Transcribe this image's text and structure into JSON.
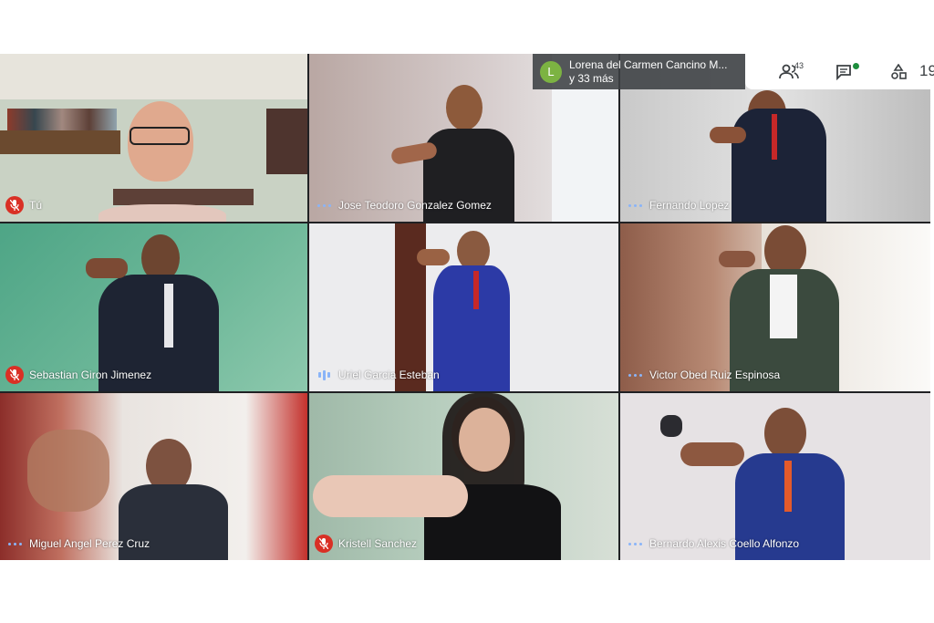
{
  "presenter": {
    "initial": "L",
    "line1": "Lorena del Carmen Cancino M...",
    "line2": "y 33 más"
  },
  "toolbar": {
    "people_icon": "people-icon",
    "participant_count": "43",
    "chat_icon": "chat-icon",
    "activities_icon": "activities-icon",
    "clock_partial": "19"
  },
  "tiles": [
    {
      "name": "Tú",
      "status": "muted"
    },
    {
      "name": "Jose Teodoro Gonzalez Gomez",
      "status": "dots"
    },
    {
      "name": "Fernando Lopez",
      "status": "dots"
    },
    {
      "name": "Sebastian Giron Jimenez",
      "status": "muted"
    },
    {
      "name": "Uriel Garcia Esteban",
      "status": "speaking"
    },
    {
      "name": "Victor Obed Ruiz Espinosa",
      "status": "dots"
    },
    {
      "name": "Miguel Angel Perez Cruz",
      "status": "dots"
    },
    {
      "name": "Kristell Sanchez",
      "status": "muted"
    },
    {
      "name": "Bernardo Alexis Coello Alfonzo",
      "status": "dots"
    }
  ],
  "colors": {
    "muted_red": "#d93025",
    "indicator_blue": "#8ab4f8",
    "avatar_green": "#7cb342"
  }
}
